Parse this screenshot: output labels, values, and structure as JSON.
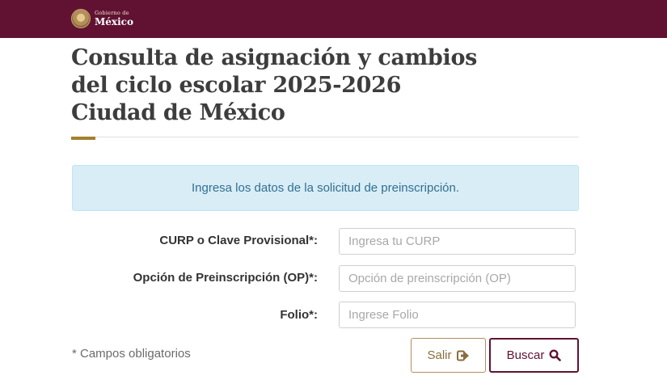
{
  "header": {
    "logo_small": "Gobierno de",
    "logo_big": "México",
    "bar_color": "#611232"
  },
  "title_lines": [
    "Consulta de asignación y cambios",
    "del ciclo escolar 2025-2026",
    "Ciudad de México"
  ],
  "alert": {
    "text": "Ingresa los datos de la solicitud de preinscripción."
  },
  "form": {
    "curp": {
      "label": "CURP o Clave Provisional*:",
      "placeholder": "Ingresa tu CURP",
      "value": ""
    },
    "op": {
      "label": "Opción de Preinscripción (OP)*:",
      "placeholder": "Opción de preinscripción (OP)",
      "value": ""
    },
    "folio": {
      "label": "Folio*:",
      "placeholder": "Ingrese Folio",
      "value": ""
    },
    "required_note": "* Campos obligatorios"
  },
  "buttons": {
    "exit": {
      "label": "Salir",
      "icon": "sign-out-icon"
    },
    "search": {
      "label": "Buscar",
      "icon": "search-icon"
    }
  },
  "colors": {
    "primary": "#611232",
    "accent": "#a57f2c",
    "info_bg": "#d9edf7",
    "info_text": "#31708f"
  }
}
